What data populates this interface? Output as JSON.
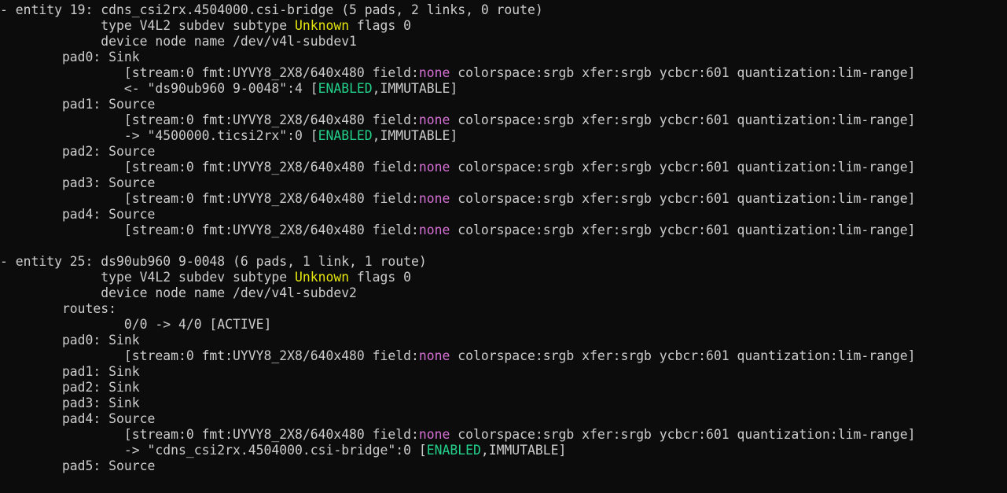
{
  "colors": {
    "background": "#0c0c0c",
    "default": "#cccccc",
    "yellow": "#e5e510",
    "magenta": "#d670d6",
    "green": "#23d18b"
  },
  "terminal": {
    "lines": [
      {
        "name": "entity-19-header",
        "segments": [
          {
            "t": "- entity 19: cdns_csi2rx.4504000.csi-bridge (5 pads, 2 links, 0 route)",
            "c": "default"
          }
        ]
      },
      {
        "name": "entity-19-type",
        "segments": [
          {
            "t": "             type V4L2 subdev subtype ",
            "c": "default"
          },
          {
            "t": "Unknown",
            "c": "yellow"
          },
          {
            "t": " flags 0",
            "c": "default"
          }
        ]
      },
      {
        "name": "entity-19-device-node",
        "segments": [
          {
            "t": "             device node name /dev/v4l-subdev1",
            "c": "default"
          }
        ]
      },
      {
        "name": "entity-19-pad0",
        "segments": [
          {
            "t": "        pad0: Sink",
            "c": "default"
          }
        ]
      },
      {
        "name": "entity-19-pad0-format",
        "segments": [
          {
            "t": "                [stream:0 fmt:UYVY8_2X8/640x480 field:",
            "c": "default"
          },
          {
            "t": "none",
            "c": "magenta"
          },
          {
            "t": " colorspace:srgb xfer:srgb ycbcr:601 quantization:lim-range]",
            "c": "default"
          }
        ]
      },
      {
        "name": "entity-19-pad0-link",
        "segments": [
          {
            "t": "                <- \"ds90ub960 9-0048\":4 [",
            "c": "default"
          },
          {
            "t": "ENABLED",
            "c": "green"
          },
          {
            "t": ",IMMUTABLE]",
            "c": "default"
          }
        ]
      },
      {
        "name": "entity-19-pad1",
        "segments": [
          {
            "t": "        pad1: Source",
            "c": "default"
          }
        ]
      },
      {
        "name": "entity-19-pad1-format",
        "segments": [
          {
            "t": "                [stream:0 fmt:UYVY8_2X8/640x480 field:",
            "c": "default"
          },
          {
            "t": "none",
            "c": "magenta"
          },
          {
            "t": " colorspace:srgb xfer:srgb ycbcr:601 quantization:lim-range]",
            "c": "default"
          }
        ]
      },
      {
        "name": "entity-19-pad1-link",
        "segments": [
          {
            "t": "                -> \"4500000.ticsi2rx\":0 [",
            "c": "default"
          },
          {
            "t": "ENABLED",
            "c": "green"
          },
          {
            "t": ",IMMUTABLE]",
            "c": "default"
          }
        ]
      },
      {
        "name": "entity-19-pad2",
        "segments": [
          {
            "t": "        pad2: Source",
            "c": "default"
          }
        ]
      },
      {
        "name": "entity-19-pad2-format",
        "segments": [
          {
            "t": "                [stream:0 fmt:UYVY8_2X8/640x480 field:",
            "c": "default"
          },
          {
            "t": "none",
            "c": "magenta"
          },
          {
            "t": " colorspace:srgb xfer:srgb ycbcr:601 quantization:lim-range]",
            "c": "default"
          }
        ]
      },
      {
        "name": "entity-19-pad3",
        "segments": [
          {
            "t": "        pad3: Source",
            "c": "default"
          }
        ]
      },
      {
        "name": "entity-19-pad3-format",
        "segments": [
          {
            "t": "                [stream:0 fmt:UYVY8_2X8/640x480 field:",
            "c": "default"
          },
          {
            "t": "none",
            "c": "magenta"
          },
          {
            "t": " colorspace:srgb xfer:srgb ycbcr:601 quantization:lim-range]",
            "c": "default"
          }
        ]
      },
      {
        "name": "entity-19-pad4",
        "segments": [
          {
            "t": "        pad4: Source",
            "c": "default"
          }
        ]
      },
      {
        "name": "entity-19-pad4-format",
        "segments": [
          {
            "t": "                [stream:0 fmt:UYVY8_2X8/640x480 field:",
            "c": "default"
          },
          {
            "t": "none",
            "c": "magenta"
          },
          {
            "t": " colorspace:srgb xfer:srgb ycbcr:601 quantization:lim-range]",
            "c": "default"
          }
        ]
      },
      {
        "name": "blank-line",
        "segments": [
          {
            "t": "",
            "c": "default"
          }
        ]
      },
      {
        "name": "entity-25-header",
        "segments": [
          {
            "t": "- entity 25: ds90ub960 9-0048 (6 pads, 1 link, 1 route)",
            "c": "default"
          }
        ]
      },
      {
        "name": "entity-25-type",
        "segments": [
          {
            "t": "             type V4L2 subdev subtype ",
            "c": "default"
          },
          {
            "t": "Unknown",
            "c": "yellow"
          },
          {
            "t": " flags 0",
            "c": "default"
          }
        ]
      },
      {
        "name": "entity-25-device-node",
        "segments": [
          {
            "t": "             device node name /dev/v4l-subdev2",
            "c": "default"
          }
        ]
      },
      {
        "name": "entity-25-routes",
        "segments": [
          {
            "t": "        routes:",
            "c": "default"
          }
        ]
      },
      {
        "name": "entity-25-route-0",
        "segments": [
          {
            "t": "                0/0 -> 4/0 [ACTIVE]",
            "c": "default"
          }
        ]
      },
      {
        "name": "entity-25-pad0",
        "segments": [
          {
            "t": "        pad0: Sink",
            "c": "default"
          }
        ]
      },
      {
        "name": "entity-25-pad0-format",
        "segments": [
          {
            "t": "                [stream:0 fmt:UYVY8_2X8/640x480 field:",
            "c": "default"
          },
          {
            "t": "none",
            "c": "magenta"
          },
          {
            "t": " colorspace:srgb xfer:srgb ycbcr:601 quantization:lim-range]",
            "c": "default"
          }
        ]
      },
      {
        "name": "entity-25-pad1",
        "segments": [
          {
            "t": "        pad1: Sink",
            "c": "default"
          }
        ]
      },
      {
        "name": "entity-25-pad2",
        "segments": [
          {
            "t": "        pad2: Sink",
            "c": "default"
          }
        ]
      },
      {
        "name": "entity-25-pad3",
        "segments": [
          {
            "t": "        pad3: Sink",
            "c": "default"
          }
        ]
      },
      {
        "name": "entity-25-pad4",
        "segments": [
          {
            "t": "        pad4: Source",
            "c": "default"
          }
        ]
      },
      {
        "name": "entity-25-pad4-format",
        "segments": [
          {
            "t": "                [stream:0 fmt:UYVY8_2X8/640x480 field:",
            "c": "default"
          },
          {
            "t": "none",
            "c": "magenta"
          },
          {
            "t": " colorspace:srgb xfer:srgb ycbcr:601 quantization:lim-range]",
            "c": "default"
          }
        ]
      },
      {
        "name": "entity-25-pad4-link",
        "segments": [
          {
            "t": "                -> \"cdns_csi2rx.4504000.csi-bridge\":0 [",
            "c": "default"
          },
          {
            "t": "ENABLED",
            "c": "green"
          },
          {
            "t": ",IMMUTABLE]",
            "c": "default"
          }
        ]
      },
      {
        "name": "entity-25-pad5",
        "segments": [
          {
            "t": "        pad5: Source",
            "c": "default"
          }
        ]
      }
    ]
  }
}
